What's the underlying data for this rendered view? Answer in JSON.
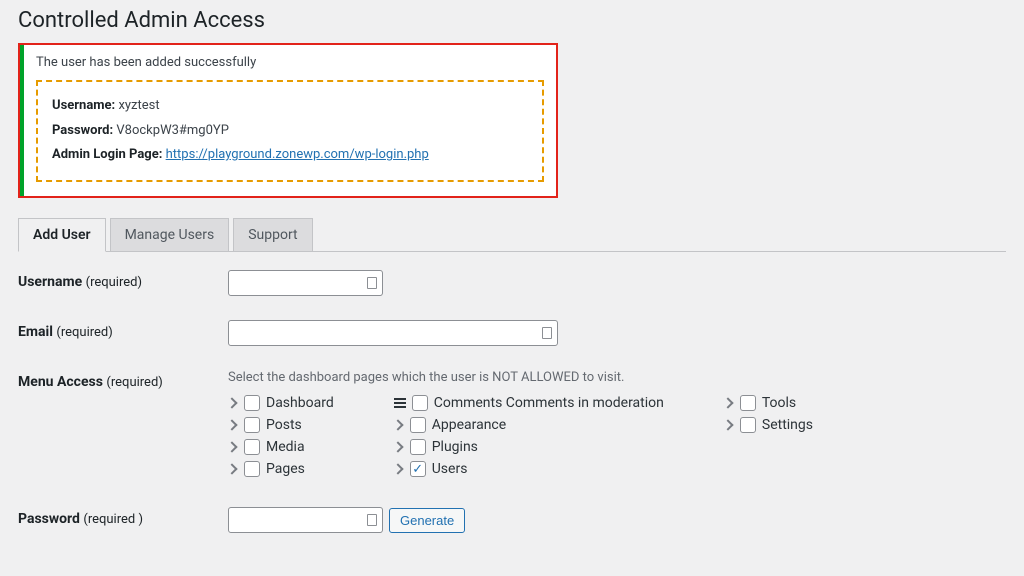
{
  "page_title": "Controlled Admin Access",
  "notice": {
    "message": "The user has been added successfully",
    "username_label": "Username:",
    "username_value": "xyztest",
    "password_label": "Password:",
    "password_value": "V8ockpW3#mg0YP",
    "login_label": "Admin Login Page:",
    "login_url": "https://playground.zonewp.com/wp-login.php"
  },
  "tabs": {
    "add_user": "Add User",
    "manage_users": "Manage Users",
    "support": "Support"
  },
  "form": {
    "username_label": "Username",
    "email_label": "Email",
    "menu_access_label": "Menu Access",
    "password_label": "Password",
    "required": "(required)",
    "required_sp": "(required )",
    "menu_hint": "Select the dashboard pages which the user is NOT ALLOWED to visit.",
    "generate": "Generate"
  },
  "menu": {
    "col1": [
      "Dashboard",
      "Posts",
      "Media",
      "Pages"
    ],
    "col2": [
      {
        "label": "Comments Comments in moderation",
        "icon": "hamburger",
        "checked": false
      },
      {
        "label": "Appearance",
        "icon": "chevron",
        "checked": false
      },
      {
        "label": "Plugins",
        "icon": "chevron",
        "checked": false
      },
      {
        "label": "Users",
        "icon": "chevron",
        "checked": true
      }
    ],
    "col3": [
      "Tools",
      "Settings"
    ]
  }
}
